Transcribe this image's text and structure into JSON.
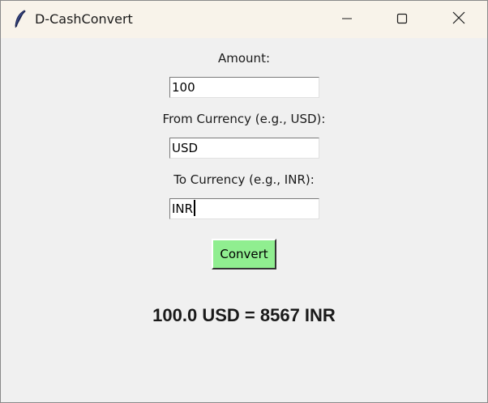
{
  "window": {
    "title": "D-CashConvert"
  },
  "titlebar_buttons": {
    "minimize_icon": "minimize-icon",
    "maximize_icon": "maximize-icon",
    "close_icon": "close-icon"
  },
  "form": {
    "amount_label": "Amount:",
    "amount_value": "100",
    "from_label": "From Currency (e.g., USD):",
    "from_value": "USD",
    "to_label": "To Currency (e.g., INR):",
    "to_value": "INR",
    "convert_label": "Convert"
  },
  "result": {
    "text": "100.0 USD = 8567 INR"
  },
  "colors": {
    "window_bg": "#f0f0f0",
    "titlebar_bg": "#f8f3ea",
    "convert_button_bg": "#90ee90"
  }
}
